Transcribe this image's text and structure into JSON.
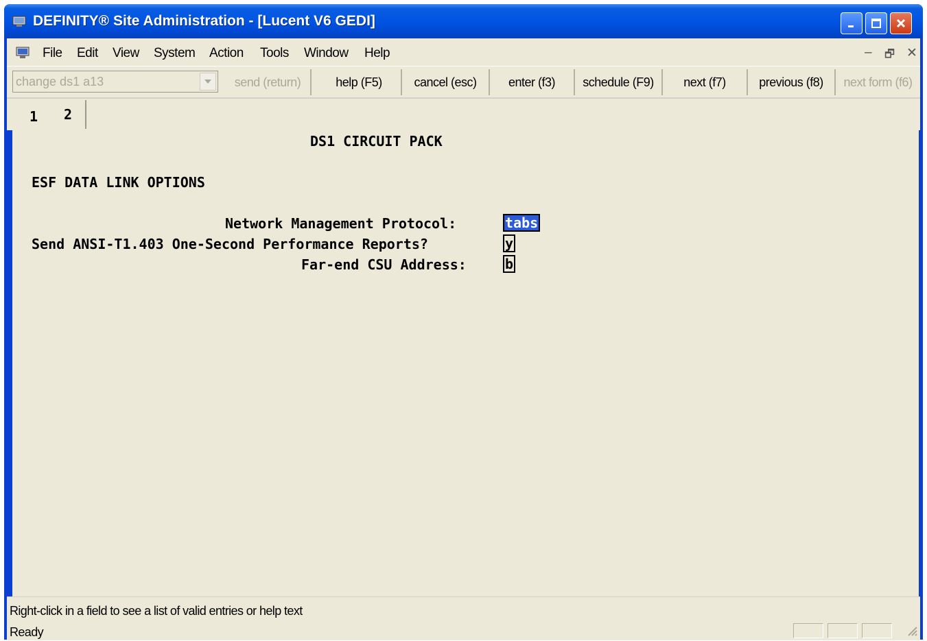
{
  "window": {
    "title": "DEFINITY® Site Administration - [Lucent V6 GEDI]"
  },
  "menu": {
    "items": [
      "File",
      "Edit",
      "View",
      "System",
      "Action",
      "Tools",
      "Window",
      "Help"
    ],
    "mdi": {
      "minimize": "–",
      "restore": "🗗",
      "close": "✕"
    }
  },
  "toolbar": {
    "command_value": "change ds1 a13",
    "buttons": [
      {
        "label": "send (return)",
        "enabled": false
      },
      {
        "label": "help (F5)",
        "enabled": true
      },
      {
        "label": "cancel (esc)",
        "enabled": true
      },
      {
        "label": "enter (f3)",
        "enabled": true
      },
      {
        "label": "schedule (F9)",
        "enabled": true
      },
      {
        "label": "next (f7)",
        "enabled": true
      },
      {
        "label": "previous (f8)",
        "enabled": true
      },
      {
        "label": "next form (f6)",
        "enabled": false
      }
    ]
  },
  "tabs": [
    {
      "label": "1",
      "active": false
    },
    {
      "label": "2",
      "active": true
    }
  ],
  "form": {
    "heading": "DS1 CIRCUIT PACK",
    "section": "ESF DATA LINK OPTIONS",
    "fields": [
      {
        "label": "Network Management Protocol:",
        "value": "tabs",
        "selected": true
      },
      {
        "label": "Send ANSI-T1.403 One-Second Performance Reports?",
        "value": "y",
        "selected": false
      },
      {
        "label": "Far-end CSU Address:",
        "value": "b",
        "selected": false
      }
    ]
  },
  "status": {
    "help_text": "Right-click in a field to see a list of valid entries or help text",
    "state": "Ready"
  },
  "colors": {
    "titlebar": "#0054e3",
    "chrome": "#ece9d8",
    "selection": "#2b5bd6"
  }
}
